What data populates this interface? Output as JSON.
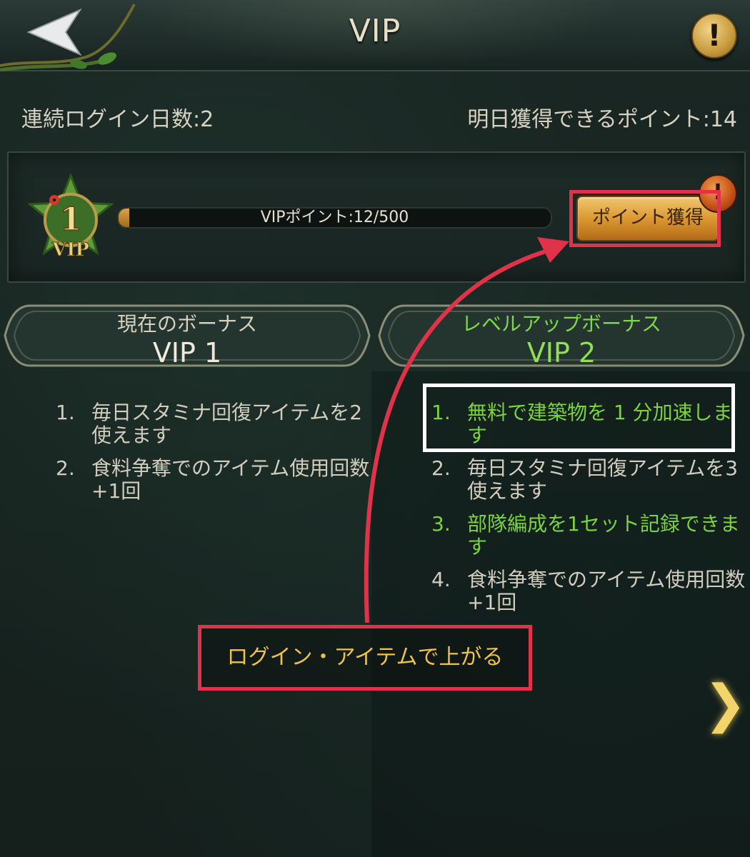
{
  "header": {
    "title": "VIP",
    "back_icon": "back-arrow-icon",
    "info_symbol": "!"
  },
  "login": {
    "days_text": "連続ログイン日数:2",
    "tomorrow_points_text": "明日獲得できるポイント:14"
  },
  "vip_status": {
    "badge_level": "1",
    "badge_text": "VIP",
    "points_label": "VIPポイント:12/500",
    "points_current": 12,
    "points_max": 500,
    "get_points_button": "ポイント獲得",
    "notice_symbol": "!"
  },
  "current_bonus": {
    "label": "現在のボーナス",
    "level": "VIP 1",
    "items": [
      {
        "num": "1.",
        "text": "毎日スタミナ回復アイテムを2使えます",
        "style": "w"
      },
      {
        "num": "2.",
        "text": "食料争奪でのアイテム使用回数+1回",
        "style": "w"
      }
    ]
  },
  "next_bonus": {
    "label": "レベルアップボーナス",
    "level": "VIP 2",
    "items": [
      {
        "num": "1.",
        "text": "無料で建築物を 1 分加速します",
        "style": "g"
      },
      {
        "num": "2.",
        "text": "毎日スタミナ回復アイテムを3使えます",
        "style": "w"
      },
      {
        "num": "3.",
        "text": "部隊編成を1セット記録できます",
        "style": "g"
      },
      {
        "num": "4.",
        "text": "食料争奪でのアイテム使用回数+1回",
        "style": "w"
      }
    ]
  },
  "annotation": {
    "text": "ログイン・アイテムで上がる"
  },
  "nav": {
    "next_symbol": "❯"
  },
  "colors": {
    "highlight_red": "#e03249",
    "green_text": "#7cd23f",
    "gold": "#f1c24a"
  }
}
